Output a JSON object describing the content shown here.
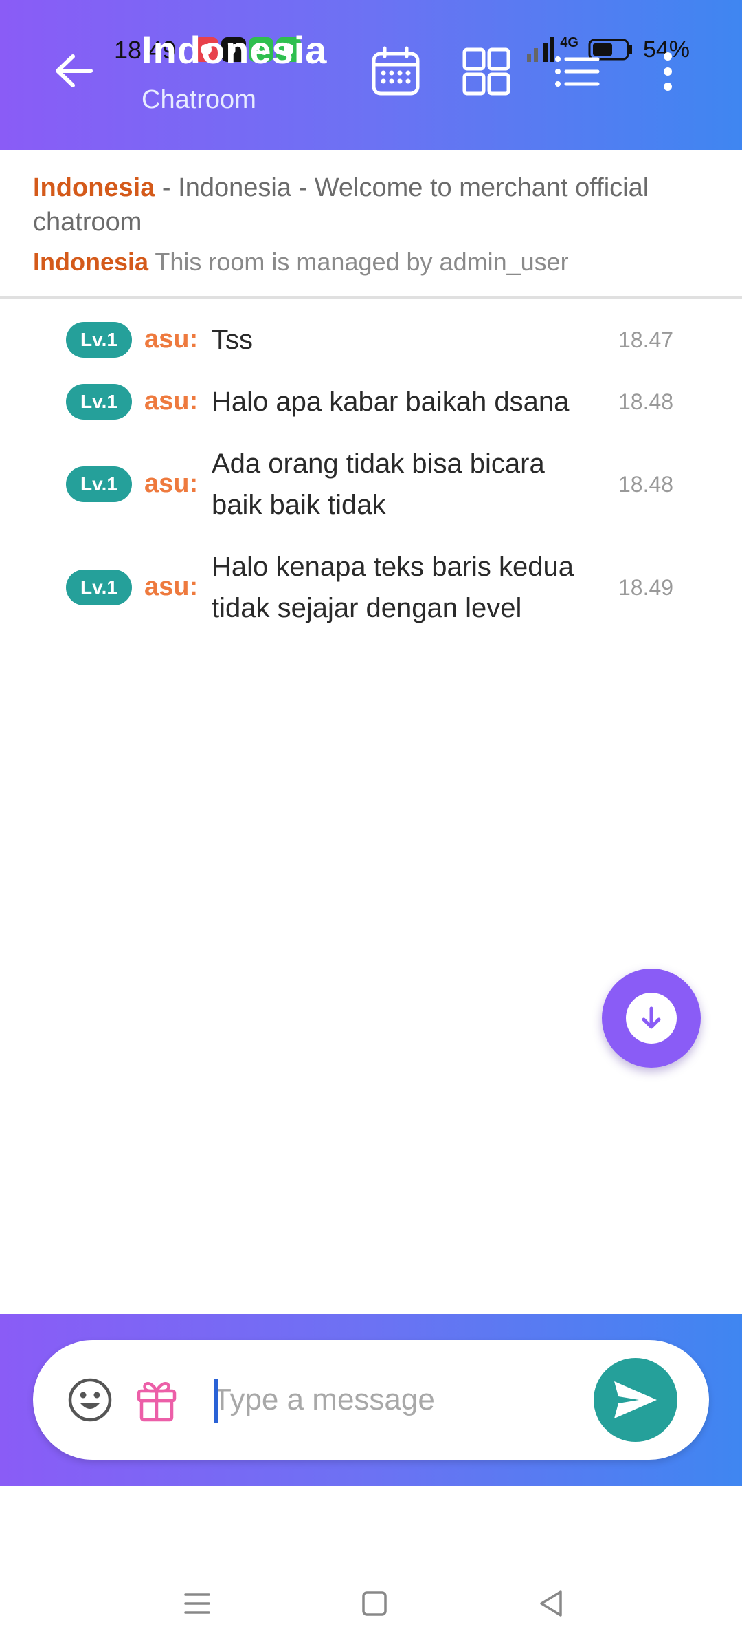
{
  "status_bar": {
    "time": "18.49",
    "network": "4G",
    "battery": "54%"
  },
  "header": {
    "title": "Indonesia",
    "subtitle": "Chatroom",
    "icons": [
      "back-arrow-icon",
      "calendar-icon",
      "grid-icon",
      "list-icon",
      "more-vertical-icon"
    ]
  },
  "info": {
    "room_name": "Indonesia",
    "welcome_rest": " - Indonesia - Welcome to merchant official chatroom",
    "room_name_2": "Indonesia",
    "managed_text": " This room is managed by admin_user"
  },
  "messages": [
    {
      "level": "Lv.1",
      "user": "asu:",
      "text": "Tss",
      "time": "18.47"
    },
    {
      "level": "Lv.1",
      "user": "asu:",
      "text": "Halo apa kabar baikah dsana",
      "time": "18.48"
    },
    {
      "level": "Lv.1",
      "user": "asu:",
      "text": "Ada orang tidak bisa bicara baik baik tidak",
      "time": "18.48"
    },
    {
      "level": "Lv.1",
      "user": "asu:",
      "text": "Halo kenapa teks baris kedua tidak sejajar dengan level",
      "time": "18.49"
    }
  ],
  "composer": {
    "placeholder": "Type a message"
  },
  "colors": {
    "accent_purple": "#8a5cf6",
    "accent_blue": "#3f86f1",
    "teal": "#25a09a",
    "orange_user": "#ee7a3e",
    "orange_room": "#d45a1a"
  }
}
